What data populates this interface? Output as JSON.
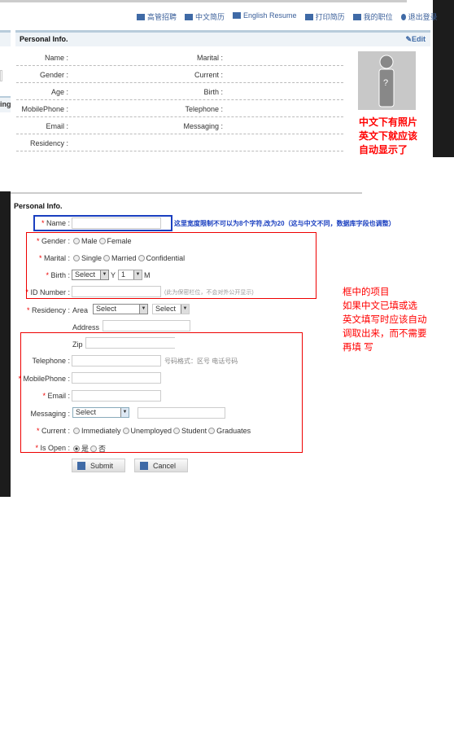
{
  "nav": [
    "高管招聘",
    "中文简历",
    "English Resume",
    "打印简历",
    "我的职位",
    "退出登录"
  ],
  "view": {
    "title": "Personal Info.",
    "edit": "Edit",
    "left_fragment": "ing",
    "left_labels": [
      "Name :",
      "Gender :",
      "Age :",
      "MobilePhone :",
      "Email :",
      "Residency :"
    ],
    "right_labels": [
      "Marital :",
      "Current :",
      "Birth :",
      "Telephone :",
      "Messaging :"
    ],
    "photo_note": [
      "中文下有照片",
      "英文下就应该",
      "自动显示了"
    ]
  },
  "form": {
    "title": "Personal Info.",
    "name_label": "Name :",
    "name_note": "这里宽度限制不可以为8个字符,改为20（这与中文不同，数据库字段也调整）",
    "gender_label": "Gender :",
    "gender_options": [
      "Male",
      "Female"
    ],
    "marital_label": "Marital :",
    "marital_options": [
      "Single",
      "Married",
      "Confidential"
    ],
    "birth_label": "Birth :",
    "birth_year": "Select",
    "y": "Y",
    "birth_month": "1",
    "m": "M",
    "id_label": "ID Number :",
    "id_note": "(此为保密栏位，不会对外公开显示)",
    "residency_label": "Residency :",
    "area": "Area",
    "area_select": "Select",
    "area_select2": "Select",
    "address": "Address",
    "zip": "Zip",
    "telephone_label": "Telephone :",
    "telephone_note": "号码格式：区号 电话号码",
    "mobile_label": "MobilePhone :",
    "email_label": "Email :",
    "messaging_label": "Messaging :",
    "messaging_select": "Select",
    "current_label": "Current :",
    "current_options": [
      "Immediately",
      "Unemployed",
      "Student",
      "Graduates"
    ],
    "open_label": "Is Open :",
    "open_options": [
      "是",
      "否"
    ],
    "submit": "Submit",
    "cancel": "Cancel",
    "box_note": [
      "框中的项目",
      "如果中文已填或选",
      "英文填写时应该自动",
      "调取出来，而不需要",
      "再填 写"
    ]
  }
}
